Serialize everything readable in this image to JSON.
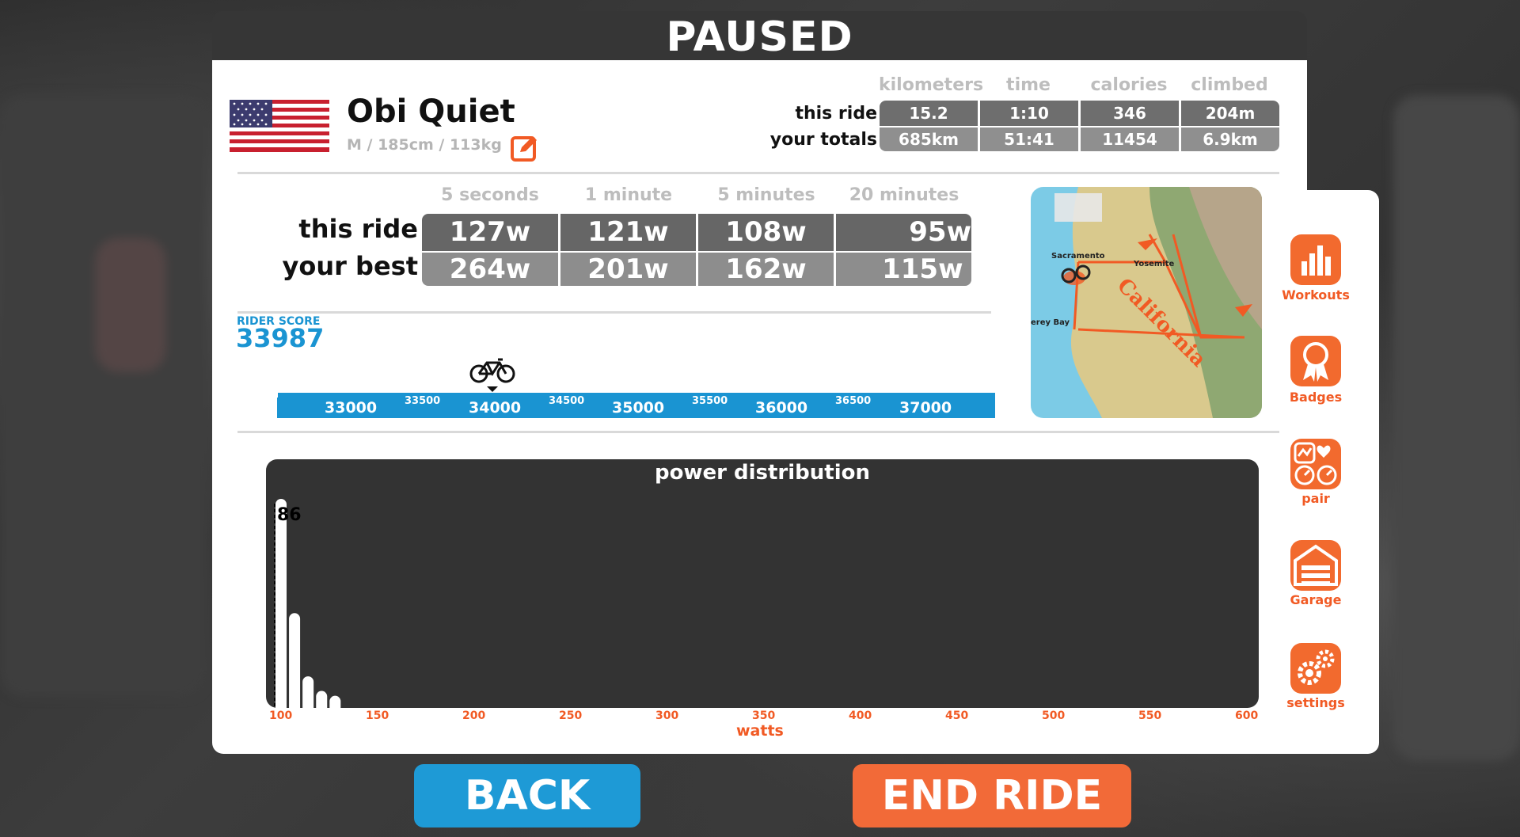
{
  "header": {
    "title": "PAUSED"
  },
  "rider": {
    "name": "Obi Quiet",
    "details": "M / 185cm / 113kg"
  },
  "ride_stats": {
    "columns": [
      "kilometers",
      "time",
      "calories",
      "climbed"
    ],
    "rows": [
      {
        "label": "this ride",
        "values": [
          "15.2",
          "1:10",
          "346",
          "204m"
        ]
      },
      {
        "label": "your totals",
        "values": [
          "685km",
          "51:41",
          "11454",
          "6.9km"
        ]
      }
    ]
  },
  "power": {
    "columns": [
      "5 seconds",
      "1 minute",
      "5 minutes",
      "20 minutes"
    ],
    "rows": [
      {
        "label": "this ride",
        "values": [
          "127w",
          "121w",
          "108w",
          "95w"
        ]
      },
      {
        "label": "your best",
        "values": [
          "264w",
          "201w",
          "162w",
          "115w"
        ]
      }
    ]
  },
  "rider_score": {
    "label": "RIDER SCORE",
    "value": "33987",
    "scale_major": [
      "33000",
      "34000",
      "35000",
      "36000",
      "37000"
    ],
    "scale_minor": [
      "33500",
      "34500",
      "35500",
      "36500"
    ]
  },
  "map": {
    "labels": [
      "Sacramento",
      "Yosemite",
      "erey Bay",
      "California"
    ]
  },
  "sidebar": {
    "items": [
      {
        "label": "Workouts",
        "icon": "bar-chart-icon"
      },
      {
        "label": "Badges",
        "icon": "ribbon-badge-icon"
      },
      {
        "label": "pair",
        "icon": "pair-sensors-icon"
      },
      {
        "label": "Garage",
        "icon": "garage-icon"
      },
      {
        "label": "settings",
        "icon": "gears-icon"
      }
    ]
  },
  "chart_data": {
    "type": "bar",
    "title": "power distribution",
    "xlabel": "watts",
    "x_ticks": [
      "100",
      "150",
      "200",
      "250",
      "300",
      "350",
      "400",
      "450",
      "500",
      "550",
      "600"
    ],
    "xlim": [
      100,
      600
    ],
    "ylim": [
      0,
      86
    ],
    "bins_x": [
      100,
      107,
      114,
      121,
      128
    ],
    "values": [
      86,
      39,
      13,
      7,
      5
    ],
    "annotation": "86"
  },
  "buttons": {
    "back": "BACK",
    "end_ride": "END RIDE"
  },
  "colors": {
    "accent": "#f15a24",
    "blue": "#1a94d2",
    "dark": "#363636"
  }
}
